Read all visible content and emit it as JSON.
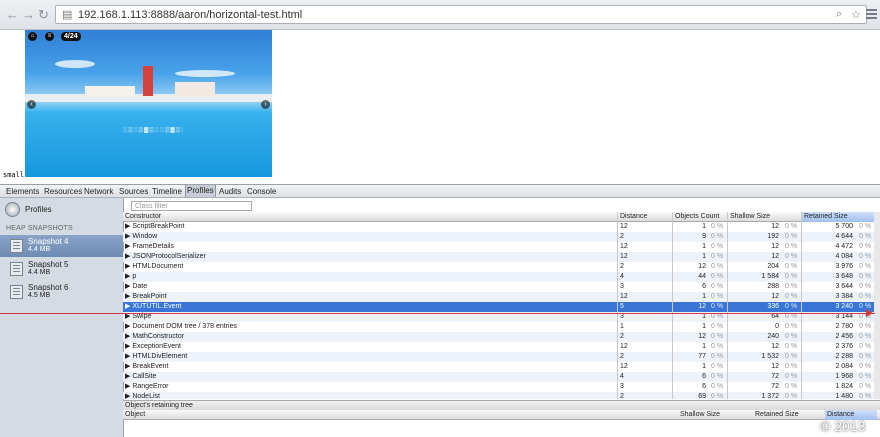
{
  "browser": {
    "url": "192.168.1.113:8888/aaron/horizontal-test.html",
    "back_glyph": "←",
    "forward_glyph": "→",
    "reload_glyph": "↻"
  },
  "page": {
    "counter": "4/24",
    "label_small": "small",
    "prev_glyph": "‹",
    "next_glyph": "›"
  },
  "devtools": {
    "tabs": [
      "Elements",
      "Resources",
      "Network",
      "Sources",
      "Timeline",
      "Profiles",
      "Audits",
      "Console"
    ],
    "selected_tab": "Profiles",
    "sidebar": {
      "title": "Profiles",
      "heap_heading": "HEAP SNAPSHOTS",
      "snapshots": [
        {
          "name": "Snapshot 4",
          "size": "4.4 MB",
          "selected": true
        },
        {
          "name": "Snapshot 5",
          "size": "4.4 MB",
          "selected": false
        },
        {
          "name": "Snapshot 6",
          "size": "4.5 MB",
          "selected": false
        }
      ]
    },
    "class_filter_placeholder": "Class filter",
    "columns": [
      "Constructor",
      "Distance",
      "Objects Count",
      "Shallow Size",
      "Retained Size"
    ],
    "sorted_column": "Retained Size",
    "rows": [
      {
        "name": "ScriptBreakPoint",
        "distance": "12",
        "count": "1",
        "count_pct": "0 %",
        "shallow": "12",
        "shallow_pct": "0 %",
        "retained": "5 700",
        "retained_pct": "0 %"
      },
      {
        "name": "Window",
        "distance": "2",
        "count": "9",
        "count_pct": "0 %",
        "shallow": "192",
        "shallow_pct": "0 %",
        "retained": "4 644",
        "retained_pct": "0 %"
      },
      {
        "name": "FrameDetails",
        "distance": "12",
        "count": "1",
        "count_pct": "0 %",
        "shallow": "12",
        "shallow_pct": "0 %",
        "retained": "4 472",
        "retained_pct": "0 %"
      },
      {
        "name": "JSONProtocolSerializer",
        "distance": "12",
        "count": "1",
        "count_pct": "0 %",
        "shallow": "12",
        "shallow_pct": "0 %",
        "retained": "4 084",
        "retained_pct": "0 %"
      },
      {
        "name": "HTMLDocument",
        "distance": "2",
        "count": "12",
        "count_pct": "0 %",
        "shallow": "204",
        "shallow_pct": "0 %",
        "retained": "3 976",
        "retained_pct": "0 %"
      },
      {
        "name": "p",
        "distance": "4",
        "count": "44",
        "count_pct": "0 %",
        "shallow": "1 584",
        "shallow_pct": "0 %",
        "retained": "3 648",
        "retained_pct": "0 %"
      },
      {
        "name": "Date",
        "distance": "3",
        "count": "6",
        "count_pct": "0 %",
        "shallow": "288",
        "shallow_pct": "0 %",
        "retained": "3 644",
        "retained_pct": "0 %"
      },
      {
        "name": "BreakPoint",
        "distance": "12",
        "count": "1",
        "count_pct": "0 %",
        "shallow": "12",
        "shallow_pct": "0 %",
        "retained": "3 384",
        "retained_pct": "0 %"
      },
      {
        "name": "XUTUTIL.Event",
        "distance": "5",
        "count": "12",
        "count_pct": "0 %",
        "shallow": "336",
        "shallow_pct": "0 %",
        "retained": "3 240",
        "retained_pct": "0 %",
        "selected": true
      },
      {
        "name": "Swipe",
        "distance": "3",
        "count": "1",
        "count_pct": "0 %",
        "shallow": "64",
        "shallow_pct": "0 %",
        "retained": "3 144",
        "retained_pct": "0 %"
      },
      {
        "name": "Document DOM tree / 378 entries",
        "distance": "1",
        "count": "1",
        "count_pct": "0 %",
        "shallow": "0",
        "shallow_pct": "0 %",
        "retained": "2 780",
        "retained_pct": "0 %"
      },
      {
        "name": "MathConstructor",
        "distance": "2",
        "count": "12",
        "count_pct": "0 %",
        "shallow": "240",
        "shallow_pct": "0 %",
        "retained": "2 456",
        "retained_pct": "0 %"
      },
      {
        "name": "ExceptionEvent",
        "distance": "12",
        "count": "1",
        "count_pct": "0 %",
        "shallow": "12",
        "shallow_pct": "0 %",
        "retained": "2 376",
        "retained_pct": "0 %"
      },
      {
        "name": "HTMLDivElement",
        "distance": "2",
        "count": "77",
        "count_pct": "0 %",
        "shallow": "1 532",
        "shallow_pct": "0 %",
        "retained": "2 288",
        "retained_pct": "0 %"
      },
      {
        "name": "BreakEvent",
        "distance": "12",
        "count": "1",
        "count_pct": "0 %",
        "shallow": "12",
        "shallow_pct": "0 %",
        "retained": "2 084",
        "retained_pct": "0 %"
      },
      {
        "name": "CallSite",
        "distance": "4",
        "count": "6",
        "count_pct": "0 %",
        "shallow": "72",
        "shallow_pct": "0 %",
        "retained": "1 968",
        "retained_pct": "0 %"
      },
      {
        "name": "RangeError",
        "distance": "3",
        "count": "6",
        "count_pct": "0 %",
        "shallow": "72",
        "shallow_pct": "0 %",
        "retained": "1 824",
        "retained_pct": "0 %"
      },
      {
        "name": "NodeList",
        "distance": "2",
        "count": "69",
        "count_pct": "0 %",
        "shallow": "1 372",
        "shallow_pct": "0 %",
        "retained": "1 480",
        "retained_pct": "0 %"
      }
    ],
    "retaining_tree_title": "Object's retaining tree",
    "retaining_columns": [
      "Object",
      "Shallow Size",
      "Retained Size",
      "Distance"
    ],
    "retaining_sorted": "Distance"
  },
  "watermark": "© 2013",
  "colors": {
    "selection": "#3875d7",
    "sidebar_bg": "#d5dbe3",
    "marker": "#d43a3a"
  }
}
